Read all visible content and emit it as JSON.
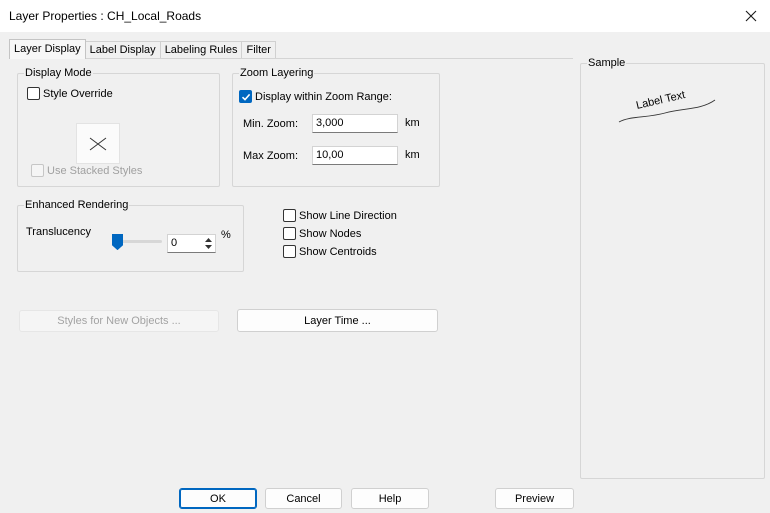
{
  "window": {
    "title": "Layer Properties  : CH_Local_Roads"
  },
  "tabs": [
    {
      "label": "Layer Display",
      "active": true
    },
    {
      "label": "Label Display",
      "active": false
    },
    {
      "label": "Labeling Rules",
      "active": false
    },
    {
      "label": "Filter",
      "active": false
    }
  ],
  "display_mode": {
    "title": "Display Mode",
    "style_override": {
      "label": "Style Override",
      "checked": false
    },
    "use_stacked_styles": {
      "label": "Use Stacked Styles",
      "checked": false,
      "enabled": false
    }
  },
  "zoom_layering": {
    "title": "Zoom Layering",
    "display_within": {
      "label": "Display within Zoom Range:",
      "checked": true
    },
    "min_zoom": {
      "label": "Min. Zoom:",
      "value": "3,000",
      "unit": "km"
    },
    "max_zoom": {
      "label": "Max Zoom:",
      "value": "10,00",
      "unit": "km"
    }
  },
  "enhanced_rendering": {
    "title": "Enhanced Rendering",
    "translucency": {
      "label": "Translucency",
      "value": "0",
      "unit": "%",
      "slider_fraction": 0
    }
  },
  "options": [
    {
      "label": "Show Line Direction",
      "checked": false
    },
    {
      "label": "Show Nodes",
      "checked": false
    },
    {
      "label": "Show Centroids",
      "checked": false
    }
  ],
  "buttons": {
    "styles_new_objects": "Styles for New Objects ...",
    "layer_time": "Layer Time ...",
    "ok": "OK",
    "cancel": "Cancel",
    "help": "Help",
    "preview": "Preview"
  },
  "sample": {
    "title": "Sample",
    "label_text": "Label Text"
  },
  "colors": {
    "accent": "#0067c0",
    "window_bg": "#f0f0f0"
  }
}
